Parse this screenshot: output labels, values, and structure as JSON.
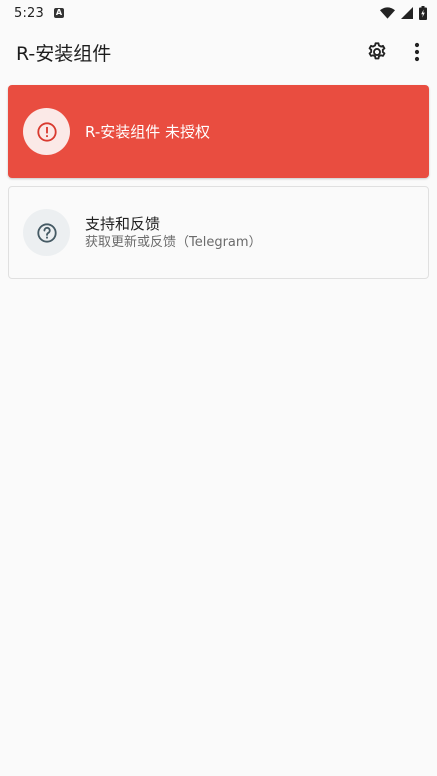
{
  "status_bar": {
    "time": "5:23",
    "notification_badge": "A",
    "icons": [
      "wifi-icon",
      "cell-signal-icon",
      "battery-icon"
    ]
  },
  "app_bar": {
    "title": "R-安装组件",
    "actions": [
      "settings-gear-icon",
      "more-vert-icon"
    ]
  },
  "warning_card": {
    "text": "R-安装组件 未授权",
    "icon": "alert-circle-icon",
    "color": "#e94d40"
  },
  "support_card": {
    "title": "支持和反馈",
    "subtitle": "获取更新或反馈（Telegram）",
    "icon": "help-circle-icon"
  }
}
